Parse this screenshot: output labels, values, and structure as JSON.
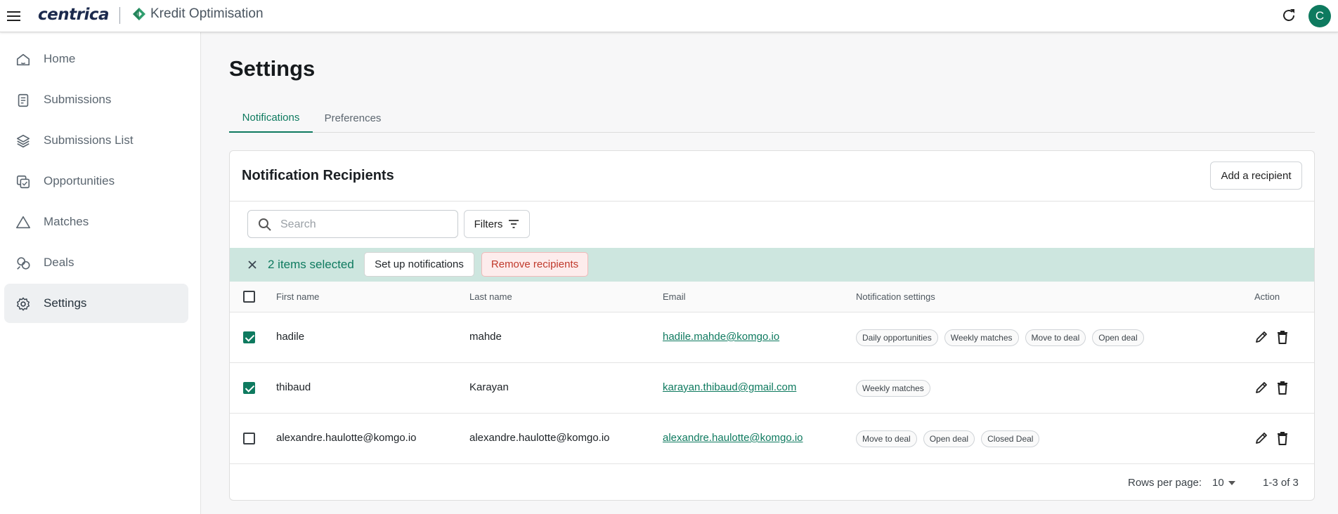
{
  "header": {
    "brand": "centrica",
    "product": "Kredit Optimisation",
    "avatar_letter": "C"
  },
  "sidebar": {
    "items": [
      {
        "label": "Home",
        "icon": "home-icon"
      },
      {
        "label": "Submissions",
        "icon": "document-icon"
      },
      {
        "label": "Submissions List",
        "icon": "layers-icon"
      },
      {
        "label": "Opportunities",
        "icon": "opportunities-icon"
      },
      {
        "label": "Matches",
        "icon": "triangle-icon"
      },
      {
        "label": "Deals",
        "icon": "deals-icon"
      },
      {
        "label": "Settings",
        "icon": "gear-icon",
        "active": true
      }
    ]
  },
  "page": {
    "title": "Settings",
    "tabs": [
      {
        "label": "Notifications",
        "active": true
      },
      {
        "label": "Preferences",
        "active": false
      }
    ]
  },
  "card": {
    "title": "Notification Recipients",
    "add_button": "Add a recipient",
    "search_placeholder": "Search",
    "filters_label": "Filters"
  },
  "selection": {
    "count_text": "2 items selected",
    "setup_button": "Set up notifications",
    "remove_button": "Remove recipients"
  },
  "table": {
    "headers": [
      "First name",
      "Last name",
      "Email",
      "Notification settings",
      "Action"
    ],
    "rows": [
      {
        "checked": true,
        "first": "hadile",
        "last": "mahde",
        "email": "hadile.mahde@komgo.io",
        "settings": [
          "Daily opportunities",
          "Weekly matches",
          "Move to deal",
          "Open deal"
        ]
      },
      {
        "checked": true,
        "first": "thibaud",
        "last": "Karayan",
        "email": "karayan.thibaud@gmail.com",
        "settings": [
          "Weekly matches"
        ]
      },
      {
        "checked": false,
        "first": "alexandre.haulotte@komgo.io",
        "last": "alexandre.haulotte@komgo.io",
        "email": "alexandre.haulotte@komgo.io",
        "settings": [
          "Move to deal",
          "Open deal",
          "Closed Deal"
        ]
      }
    ]
  },
  "pagination": {
    "rows_per_page_label": "Rows per page:",
    "rows_per_page_value": "10",
    "range": "1-3 of 3"
  },
  "colors": {
    "accent": "#0e7a5f",
    "selection_bar": "#cde6df",
    "danger": "#c0392b"
  }
}
